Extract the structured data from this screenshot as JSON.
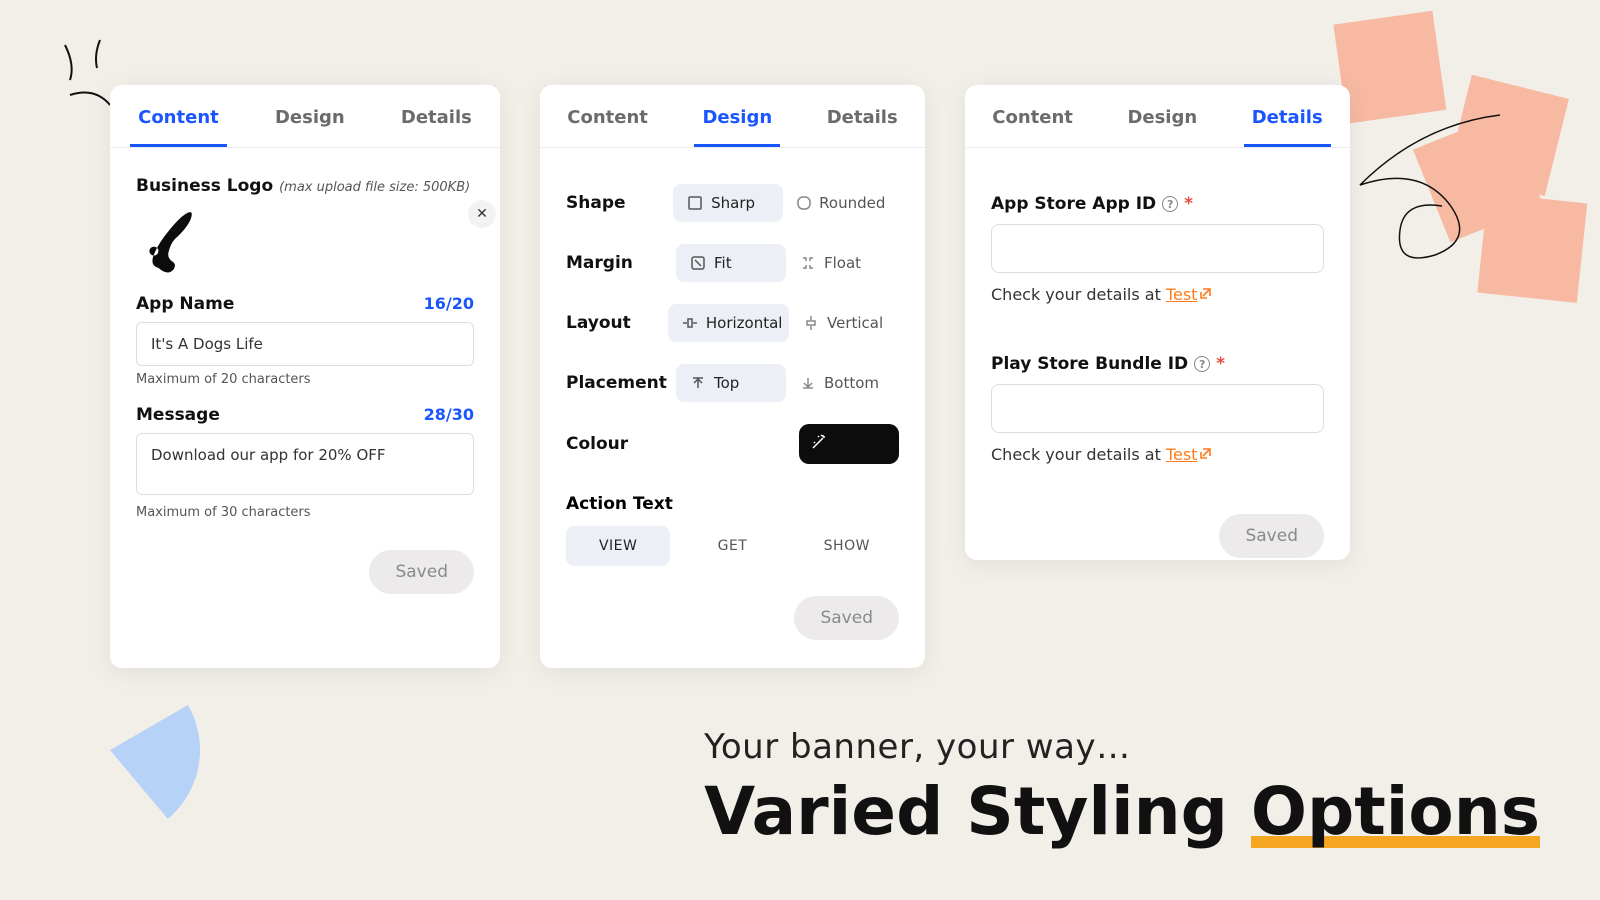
{
  "tabs": {
    "content": "Content",
    "design": "Design",
    "details": "Details"
  },
  "content_card": {
    "logo_label": "Business Logo",
    "logo_hint": "(max upload file size: 500KB)",
    "name_label": "App Name",
    "name_counter": "16/20",
    "name_value": "It's A Dogs Life",
    "name_helper": "Maximum of 20 characters",
    "msg_label": "Message",
    "msg_counter": "28/30",
    "msg_value": "Download our app for 20% OFF",
    "msg_helper": "Maximum of 30 characters",
    "saved": "Saved"
  },
  "design_card": {
    "shape": {
      "label": "Shape",
      "a": "Sharp",
      "b": "Rounded"
    },
    "margin": {
      "label": "Margin",
      "a": "Fit",
      "b": "Float"
    },
    "layout": {
      "label": "Layout",
      "a": "Horizontal",
      "b": "Vertical"
    },
    "placement": {
      "label": "Placement",
      "a": "Top",
      "b": "Bottom"
    },
    "colour": {
      "label": "Colour"
    },
    "action": {
      "label": "Action Text",
      "view": "VIEW",
      "get": "GET",
      "show": "SHOW"
    },
    "saved": "Saved"
  },
  "details_card": {
    "app_label": "App Store App ID",
    "play_label": "Play Store Bundle ID",
    "help_prefix": "Check your details at  ",
    "test": "Test",
    "saved": "Saved"
  },
  "marketing": {
    "sub": "Your banner, your way…",
    "headline_a": "Varied Styling ",
    "headline_b": "Options"
  }
}
